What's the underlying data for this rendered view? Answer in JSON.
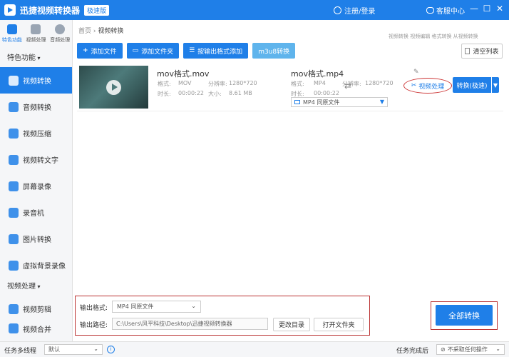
{
  "titlebar": {
    "app_title": "迅捷视频转换器",
    "badge": "极速版",
    "login": "注册/登录",
    "service": "客服中心",
    "min": "—",
    "max": "☐",
    "close": "✕"
  },
  "sidebar": {
    "top_tabs": [
      "特色功能",
      "视频处理",
      "音频处理"
    ],
    "section1": "特色功能",
    "items": [
      "视频转换",
      "音频转换",
      "视频压缩",
      "视频转文字",
      "屏幕录像",
      "录音机",
      "图片转换",
      "虚拟背景录像"
    ],
    "section2": "视频处理",
    "items2": [
      "视频剪辑",
      "视频合并"
    ]
  },
  "breadcrumb": {
    "home": "首页",
    "sep": "›",
    "current": "视频转换"
  },
  "top_right_text": "视频转换   视频编辑   格式转换   从视频转换",
  "toolbar": {
    "add_file": "添加文件",
    "add_folder": "添加文件夹",
    "add_by_format": "按输出格式添加",
    "m3u8": "m3u8转换",
    "clear": "清空列表"
  },
  "file": {
    "src_name": "mov格式.mov",
    "src_format_label": "格式:",
    "src_format": "MOV",
    "src_res_label": "分辨率:",
    "src_res": "1280*720",
    "src_dur_label": "时长:",
    "src_dur": "00:00:22",
    "src_size_label": "大小:",
    "src_size": "8.61 MB",
    "out_name": "mov格式.mp4",
    "out_format_label": "格式:",
    "out_format": "MP4",
    "out_res_label": "分辨率:",
    "out_res": "1280*720",
    "out_dur_label": "时长:",
    "out_dur": "00:00:22",
    "out_select": "MP4   同原文件",
    "video_process": "视频处理",
    "convert": "转换(极速)"
  },
  "output": {
    "format_label": "输出格式:",
    "format_value": "MP4   同原文件",
    "path_label": "输出路径:",
    "path_value": "C:\\Users\\风平科技\\Desktop\\迅捷视频转换器",
    "change_dir": "更改目录",
    "open_folder": "打开文件夹",
    "convert_all": "全部转换"
  },
  "statusbar": {
    "multi_thread": "任务多线程",
    "thread_value": "默认",
    "after_done": "任务完成后",
    "after_value": "不采取任何操作"
  }
}
